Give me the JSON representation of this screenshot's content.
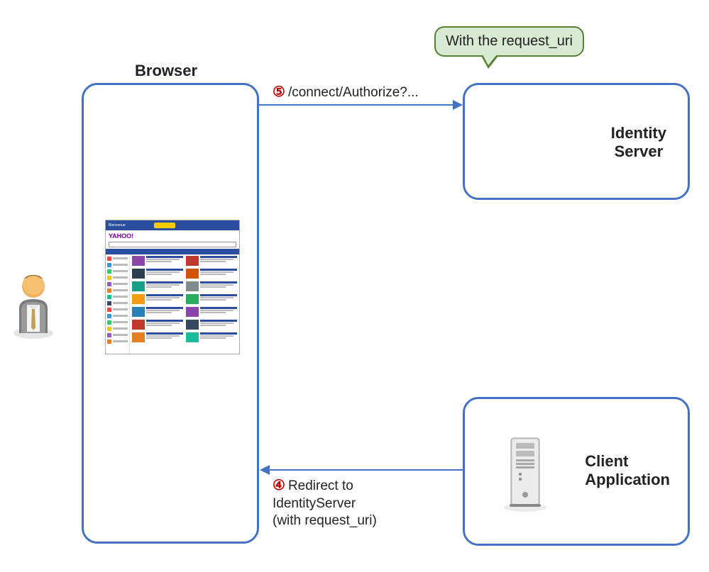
{
  "browser": {
    "title": "Browser",
    "thumb_logo": "YAHOO!"
  },
  "identity_server": {
    "title_line1": "Identity",
    "title_line2": "Server"
  },
  "client_app": {
    "title_line1": "Client",
    "title_line2": "Application"
  },
  "speech": {
    "text": "With the request_uri"
  },
  "arrow5": {
    "num": "⑤",
    "text": "/connect/Authorize?..."
  },
  "arrow4": {
    "num": "④",
    "text_line1": "Redirect to",
    "text_line2": "IdentityServer",
    "text_line3": "(with request_uri)"
  },
  "colors": {
    "blue": "#4472C4",
    "red": "#C00000",
    "speech_bg": "#D9EAD3",
    "speech_border": "#548235"
  }
}
